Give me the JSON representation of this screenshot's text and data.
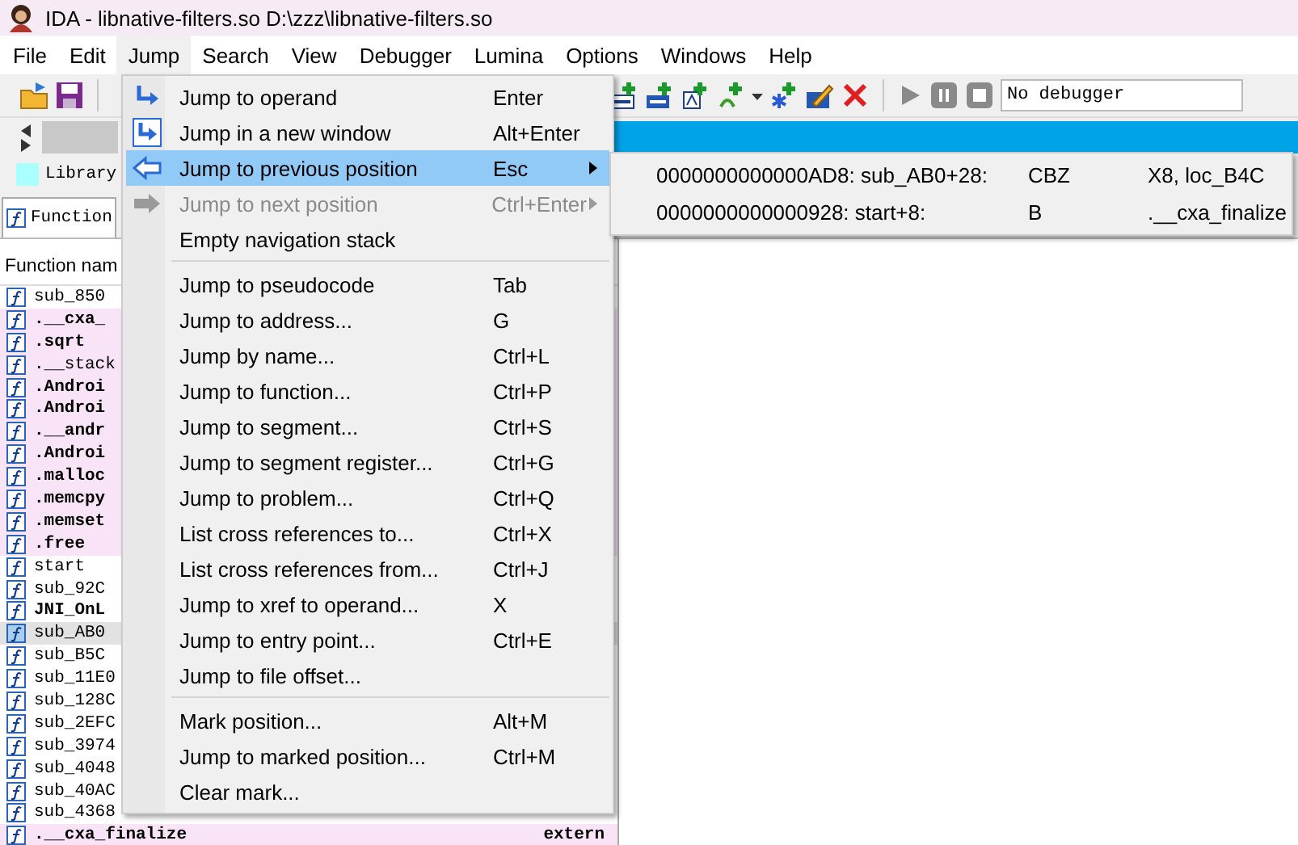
{
  "window": {
    "title": "IDA - libnative-filters.so D:\\zzz\\libnative-filters.so"
  },
  "menu_bar": [
    {
      "label": "File",
      "selected": false
    },
    {
      "label": "Edit",
      "selected": false
    },
    {
      "label": "Jump",
      "selected": true
    },
    {
      "label": "Search",
      "selected": false
    },
    {
      "label": "View",
      "selected": false
    },
    {
      "label": "Debugger",
      "selected": false
    },
    {
      "label": "Lumina",
      "selected": false
    },
    {
      "label": "Options",
      "selected": false
    },
    {
      "label": "Windows",
      "selected": false
    },
    {
      "label": "Help",
      "selected": false
    }
  ],
  "debugger_field": {
    "value": "No debugger"
  },
  "legend": {
    "label": "Library"
  },
  "function_tab": {
    "label": "Function"
  },
  "functions": {
    "column_1": "Function nam",
    "rows": [
      {
        "name": "sub_850",
        "kind": "regular",
        "selected": false
      },
      {
        "name": ".__cxa_",
        "kind": "import",
        "selected": false
      },
      {
        "name": ".sqrt",
        "kind": "import",
        "selected": false
      },
      {
        "name": ".__stack",
        "kind": "import-light",
        "selected": false
      },
      {
        "name": ".Androi",
        "kind": "import",
        "selected": false
      },
      {
        "name": ".Androi",
        "kind": "import",
        "selected": false
      },
      {
        "name": ".__andr",
        "kind": "import",
        "selected": false
      },
      {
        "name": ".Androi",
        "kind": "import",
        "selected": false
      },
      {
        "name": ".malloc",
        "kind": "import",
        "selected": false
      },
      {
        "name": ".memcpy",
        "kind": "import",
        "selected": false
      },
      {
        "name": ".memset",
        "kind": "import",
        "selected": false
      },
      {
        "name": ".free",
        "kind": "import",
        "selected": false
      },
      {
        "name": "start",
        "kind": "regular",
        "selected": false
      },
      {
        "name": "sub_92C",
        "kind": "regular",
        "selected": false
      },
      {
        "name": "JNI_OnL",
        "kind": "export",
        "selected": false
      },
      {
        "name": "sub_AB0",
        "kind": "regular",
        "selected": true
      },
      {
        "name": "sub_B5C",
        "kind": "regular",
        "selected": false
      },
      {
        "name": "sub_11E0",
        "kind": "regular",
        "selected": false
      },
      {
        "name": "sub_128C",
        "kind": "regular",
        "selected": false
      },
      {
        "name": "sub_2EFC",
        "kind": "regular",
        "selected": false
      },
      {
        "name": "sub_3974",
        "kind": "regular",
        "selected": false
      },
      {
        "name": "sub_4048",
        "kind": "regular",
        "selected": false
      },
      {
        "name": "sub_40AC",
        "kind": "regular",
        "selected": false
      },
      {
        "name": "sub_4368",
        "kind": "regular",
        "selected": false
      },
      {
        "name": ".__cxa_finalize",
        "segment": "extern",
        "kind": "import",
        "selected": false
      }
    ]
  },
  "jump_menu": {
    "groups": [
      [
        {
          "label": "Jump to operand",
          "shortcut": "Enter",
          "selected": false,
          "disabled": false,
          "submenu": false
        },
        {
          "label": "Jump in a new window",
          "shortcut": "Alt+Enter",
          "selected": false,
          "disabled": false,
          "submenu": false
        },
        {
          "label": "Jump to previous position",
          "shortcut": "Esc",
          "selected": true,
          "disabled": false,
          "submenu": true
        },
        {
          "label": "Jump to next position",
          "shortcut": "Ctrl+Enter",
          "selected": false,
          "disabled": true,
          "submenu": true
        },
        {
          "label": "Empty navigation stack",
          "selected": false,
          "disabled": false,
          "submenu": false
        }
      ],
      [
        {
          "label": "Jump to pseudocode",
          "shortcut": "Tab",
          "selected": false,
          "disabled": false,
          "submenu": false
        },
        {
          "label": "Jump to address...",
          "shortcut": "G",
          "selected": false,
          "disabled": false,
          "submenu": false
        },
        {
          "label": "Jump by name...",
          "shortcut": "Ctrl+L",
          "selected": false,
          "disabled": false,
          "submenu": false
        },
        {
          "label": "Jump to function...",
          "shortcut": "Ctrl+P",
          "selected": false,
          "disabled": false,
          "submenu": false
        },
        {
          "label": "Jump to segment...",
          "shortcut": "Ctrl+S",
          "selected": false,
          "disabled": false,
          "submenu": false
        },
        {
          "label": "Jump to segment register...",
          "shortcut": "Ctrl+G",
          "selected": false,
          "disabled": false,
          "submenu": false
        },
        {
          "label": "Jump to problem...",
          "shortcut": "Ctrl+Q",
          "selected": false,
          "disabled": false,
          "submenu": false
        },
        {
          "label": "List cross references to...",
          "shortcut": "Ctrl+X",
          "selected": false,
          "disabled": false,
          "submenu": false
        },
        {
          "label": "List cross references from...",
          "shortcut": "Ctrl+J",
          "selected": false,
          "disabled": false,
          "submenu": false
        },
        {
          "label": "Jump to xref to operand...",
          "shortcut": "X",
          "selected": false,
          "disabled": false,
          "submenu": false
        },
        {
          "label": "Jump to entry point...",
          "shortcut": "Ctrl+E",
          "selected": false,
          "disabled": false,
          "submenu": false
        },
        {
          "label": "Jump to file offset...",
          "selected": false,
          "disabled": false,
          "submenu": false
        }
      ],
      [
        {
          "label": "Mark position...",
          "shortcut": "Alt+M",
          "selected": false,
          "disabled": false,
          "submenu": false
        },
        {
          "label": "Jump to marked position...",
          "shortcut": "Ctrl+M",
          "selected": false,
          "disabled": false,
          "submenu": false
        },
        {
          "label": "Clear mark...",
          "selected": false,
          "disabled": false,
          "submenu": false
        }
      ]
    ]
  },
  "history_submenu": [
    {
      "location": "0000000000000AD8: sub_AB0+28:",
      "instruction": "CBZ",
      "operands": "X8, loc_B4C"
    },
    {
      "location": "0000000000000928: start+8:",
      "instruction": "B",
      "operands": ".__cxa_finalize"
    }
  ]
}
